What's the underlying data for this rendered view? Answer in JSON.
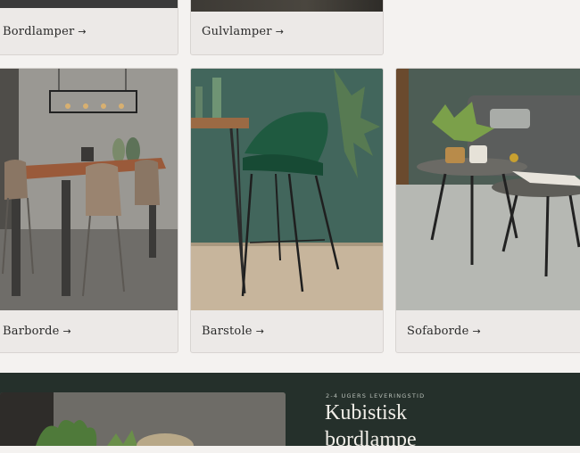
{
  "categories": [
    {
      "label": "Bordlamper",
      "arrow": "→"
    },
    {
      "label": "Gulvlamper",
      "arrow": "→"
    },
    {
      "label": "Barborde",
      "arrow": "→"
    },
    {
      "label": "Barstole",
      "arrow": "→"
    },
    {
      "label": "Sofaborde",
      "arrow": "→"
    }
  ],
  "promo": {
    "kicker": "2-4 ugers leveringstid",
    "headline_line1": "Kubistisk",
    "headline_line2": "bordlampe"
  },
  "colors": {
    "banner": "#25302b",
    "card": "#ece9e7",
    "page": "#f4f2f0"
  }
}
